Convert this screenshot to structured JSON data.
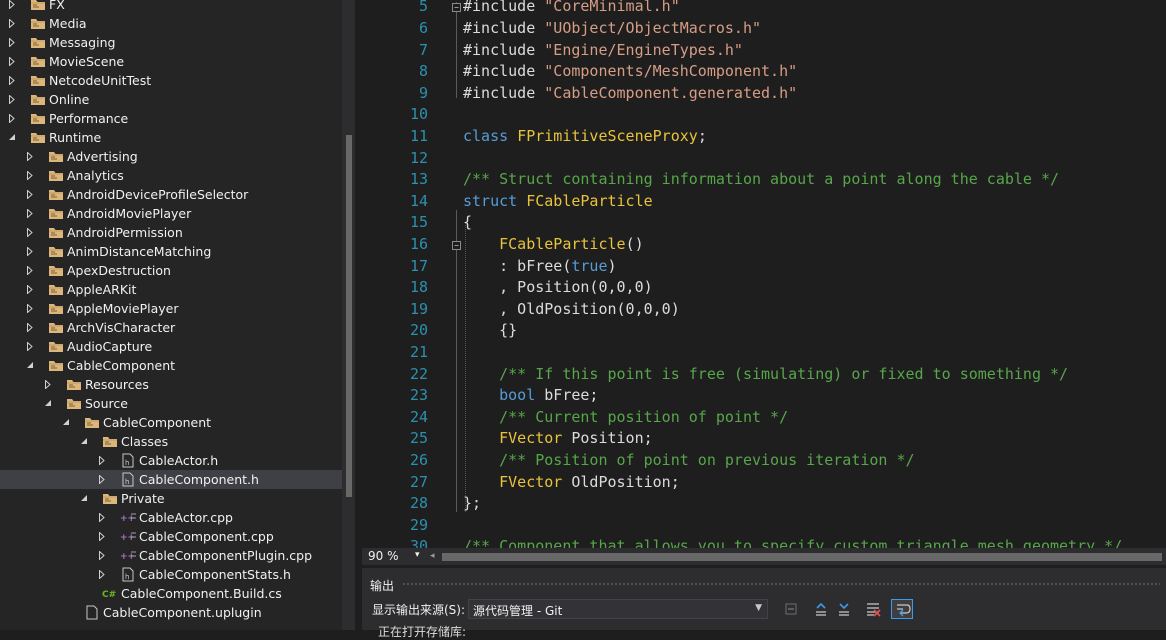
{
  "solution_explorer": {
    "items": [
      {
        "label": "FX",
        "depth": 0,
        "expanded": false,
        "kind": "folder"
      },
      {
        "label": "Media",
        "depth": 0,
        "expanded": false,
        "kind": "folder"
      },
      {
        "label": "Messaging",
        "depth": 0,
        "expanded": false,
        "kind": "folder"
      },
      {
        "label": "MovieScene",
        "depth": 0,
        "expanded": false,
        "kind": "folder"
      },
      {
        "label": "NetcodeUnitTest",
        "depth": 0,
        "expanded": false,
        "kind": "folder"
      },
      {
        "label": "Online",
        "depth": 0,
        "expanded": false,
        "kind": "folder"
      },
      {
        "label": "Performance",
        "depth": 0,
        "expanded": false,
        "kind": "folder"
      },
      {
        "label": "Runtime",
        "depth": 0,
        "expanded": true,
        "kind": "folder"
      },
      {
        "label": "Advertising",
        "depth": 1,
        "expanded": false,
        "kind": "folder"
      },
      {
        "label": "Analytics",
        "depth": 1,
        "expanded": false,
        "kind": "folder"
      },
      {
        "label": "AndroidDeviceProfileSelector",
        "depth": 1,
        "expanded": false,
        "kind": "folder"
      },
      {
        "label": "AndroidMoviePlayer",
        "depth": 1,
        "expanded": false,
        "kind": "folder"
      },
      {
        "label": "AndroidPermission",
        "depth": 1,
        "expanded": false,
        "kind": "folder"
      },
      {
        "label": "AnimDistanceMatching",
        "depth": 1,
        "expanded": false,
        "kind": "folder"
      },
      {
        "label": "ApexDestruction",
        "depth": 1,
        "expanded": false,
        "kind": "folder"
      },
      {
        "label": "AppleARKit",
        "depth": 1,
        "expanded": false,
        "kind": "folder"
      },
      {
        "label": "AppleMoviePlayer",
        "depth": 1,
        "expanded": false,
        "kind": "folder"
      },
      {
        "label": "ArchVisCharacter",
        "depth": 1,
        "expanded": false,
        "kind": "folder"
      },
      {
        "label": "AudioCapture",
        "depth": 1,
        "expanded": false,
        "kind": "folder"
      },
      {
        "label": "CableComponent",
        "depth": 1,
        "expanded": true,
        "kind": "folder"
      },
      {
        "label": "Resources",
        "depth": 2,
        "expanded": false,
        "kind": "folder"
      },
      {
        "label": "Source",
        "depth": 2,
        "expanded": true,
        "kind": "folder"
      },
      {
        "label": "CableComponent",
        "depth": 3,
        "expanded": true,
        "kind": "folder"
      },
      {
        "label": "Classes",
        "depth": 4,
        "expanded": true,
        "kind": "folder"
      },
      {
        "label": "CableActor.h",
        "depth": 5,
        "expanded": false,
        "kind": "header"
      },
      {
        "label": "CableComponent.h",
        "depth": 5,
        "expanded": false,
        "kind": "header",
        "selected": true
      },
      {
        "label": "Private",
        "depth": 4,
        "expanded": true,
        "kind": "folder"
      },
      {
        "label": "CableActor.cpp",
        "depth": 5,
        "expanded": false,
        "kind": "cpp"
      },
      {
        "label": "CableComponent.cpp",
        "depth": 5,
        "expanded": false,
        "kind": "cpp"
      },
      {
        "label": "CableComponentPlugin.cpp",
        "depth": 5,
        "expanded": false,
        "kind": "cpp"
      },
      {
        "label": "CableComponentStats.h",
        "depth": 5,
        "expanded": false,
        "kind": "header"
      },
      {
        "label": "CableComponent.Build.cs",
        "depth": 4,
        "expanded": null,
        "kind": "cs"
      },
      {
        "label": "CableComponent.uplugin",
        "depth": 3,
        "expanded": null,
        "kind": "file"
      }
    ]
  },
  "editor": {
    "lines": [
      {
        "n": "5",
        "tokens": [
          [
            "text",
            "#include "
          ],
          [
            "str",
            "\"CoreMinimal.h\""
          ]
        ]
      },
      {
        "n": "6",
        "tokens": [
          [
            "text",
            "#include "
          ],
          [
            "str",
            "\"UObject/ObjectMacros.h\""
          ]
        ]
      },
      {
        "n": "7",
        "tokens": [
          [
            "text",
            "#include "
          ],
          [
            "str",
            "\"Engine/EngineTypes.h\""
          ]
        ]
      },
      {
        "n": "8",
        "tokens": [
          [
            "text",
            "#include "
          ],
          [
            "str",
            "\"Components/MeshComponent.h\""
          ]
        ]
      },
      {
        "n": "9",
        "tokens": [
          [
            "text",
            "#include "
          ],
          [
            "str",
            "\"CableComponent.generated.h\""
          ]
        ]
      },
      {
        "n": "10",
        "tokens": []
      },
      {
        "n": "11",
        "tokens": [
          [
            "kw",
            "class "
          ],
          [
            "type",
            "FPrimitiveSceneProxy"
          ],
          [
            "text",
            ";"
          ]
        ]
      },
      {
        "n": "12",
        "tokens": []
      },
      {
        "n": "13",
        "tokens": [
          [
            "comment",
            "/** Struct containing information about a point along the cable */"
          ]
        ]
      },
      {
        "n": "14",
        "tokens": [
          [
            "kw",
            "struct "
          ],
          [
            "type",
            "FCableParticle"
          ]
        ]
      },
      {
        "n": "15",
        "tokens": [
          [
            "text",
            "{"
          ]
        ]
      },
      {
        "n": "16",
        "tokens": [
          [
            "text",
            "    "
          ],
          [
            "type",
            "FCableParticle"
          ],
          [
            "text",
            "()"
          ]
        ]
      },
      {
        "n": "17",
        "tokens": [
          [
            "text",
            "    : bFree("
          ],
          [
            "kw",
            "true"
          ],
          [
            "text",
            ")"
          ]
        ]
      },
      {
        "n": "18",
        "tokens": [
          [
            "text",
            "    , Position(0,0,0)"
          ]
        ]
      },
      {
        "n": "19",
        "tokens": [
          [
            "text",
            "    , OldPosition(0,0,0)"
          ]
        ]
      },
      {
        "n": "20",
        "tokens": [
          [
            "text",
            "    {}"
          ]
        ]
      },
      {
        "n": "21",
        "tokens": []
      },
      {
        "n": "22",
        "tokens": [
          [
            "text",
            "    "
          ],
          [
            "comment",
            "/** If this point is free (simulating) or fixed to something */"
          ]
        ]
      },
      {
        "n": "23",
        "tokens": [
          [
            "text",
            "    "
          ],
          [
            "kw",
            "bool "
          ],
          [
            "text",
            "bFree;"
          ]
        ]
      },
      {
        "n": "24",
        "tokens": [
          [
            "text",
            "    "
          ],
          [
            "comment",
            "/** Current position of point */"
          ]
        ]
      },
      {
        "n": "25",
        "tokens": [
          [
            "text",
            "    "
          ],
          [
            "type",
            "FVector "
          ],
          [
            "text",
            "Position;"
          ]
        ]
      },
      {
        "n": "26",
        "tokens": [
          [
            "text",
            "    "
          ],
          [
            "comment",
            "/** Position of point on previous iteration */"
          ]
        ]
      },
      {
        "n": "27",
        "tokens": [
          [
            "text",
            "    "
          ],
          [
            "type",
            "FVector "
          ],
          [
            "text",
            "OldPosition;"
          ]
        ]
      },
      {
        "n": "28",
        "tokens": [
          [
            "text",
            "};"
          ]
        ]
      },
      {
        "n": "29",
        "tokens": []
      },
      {
        "n": "30",
        "tokens": [
          [
            "comment",
            "/** Component that allows you to specify custom triangle mesh geometry */"
          ]
        ]
      }
    ],
    "zoom": "90 %"
  },
  "output_panel": {
    "title": "输出",
    "source_label": "显示输出来源(S):",
    "source_value": "源代码管理 - Git",
    "partial_text": "正在打开存储库:"
  },
  "colors": {
    "keyword": "#569cd6",
    "string": "#d69d85",
    "comment": "#57a64a",
    "type": "#e8c33c",
    "line_number": "#2b91af",
    "folder": "#dcb67a",
    "selection": "#3f3f46"
  }
}
